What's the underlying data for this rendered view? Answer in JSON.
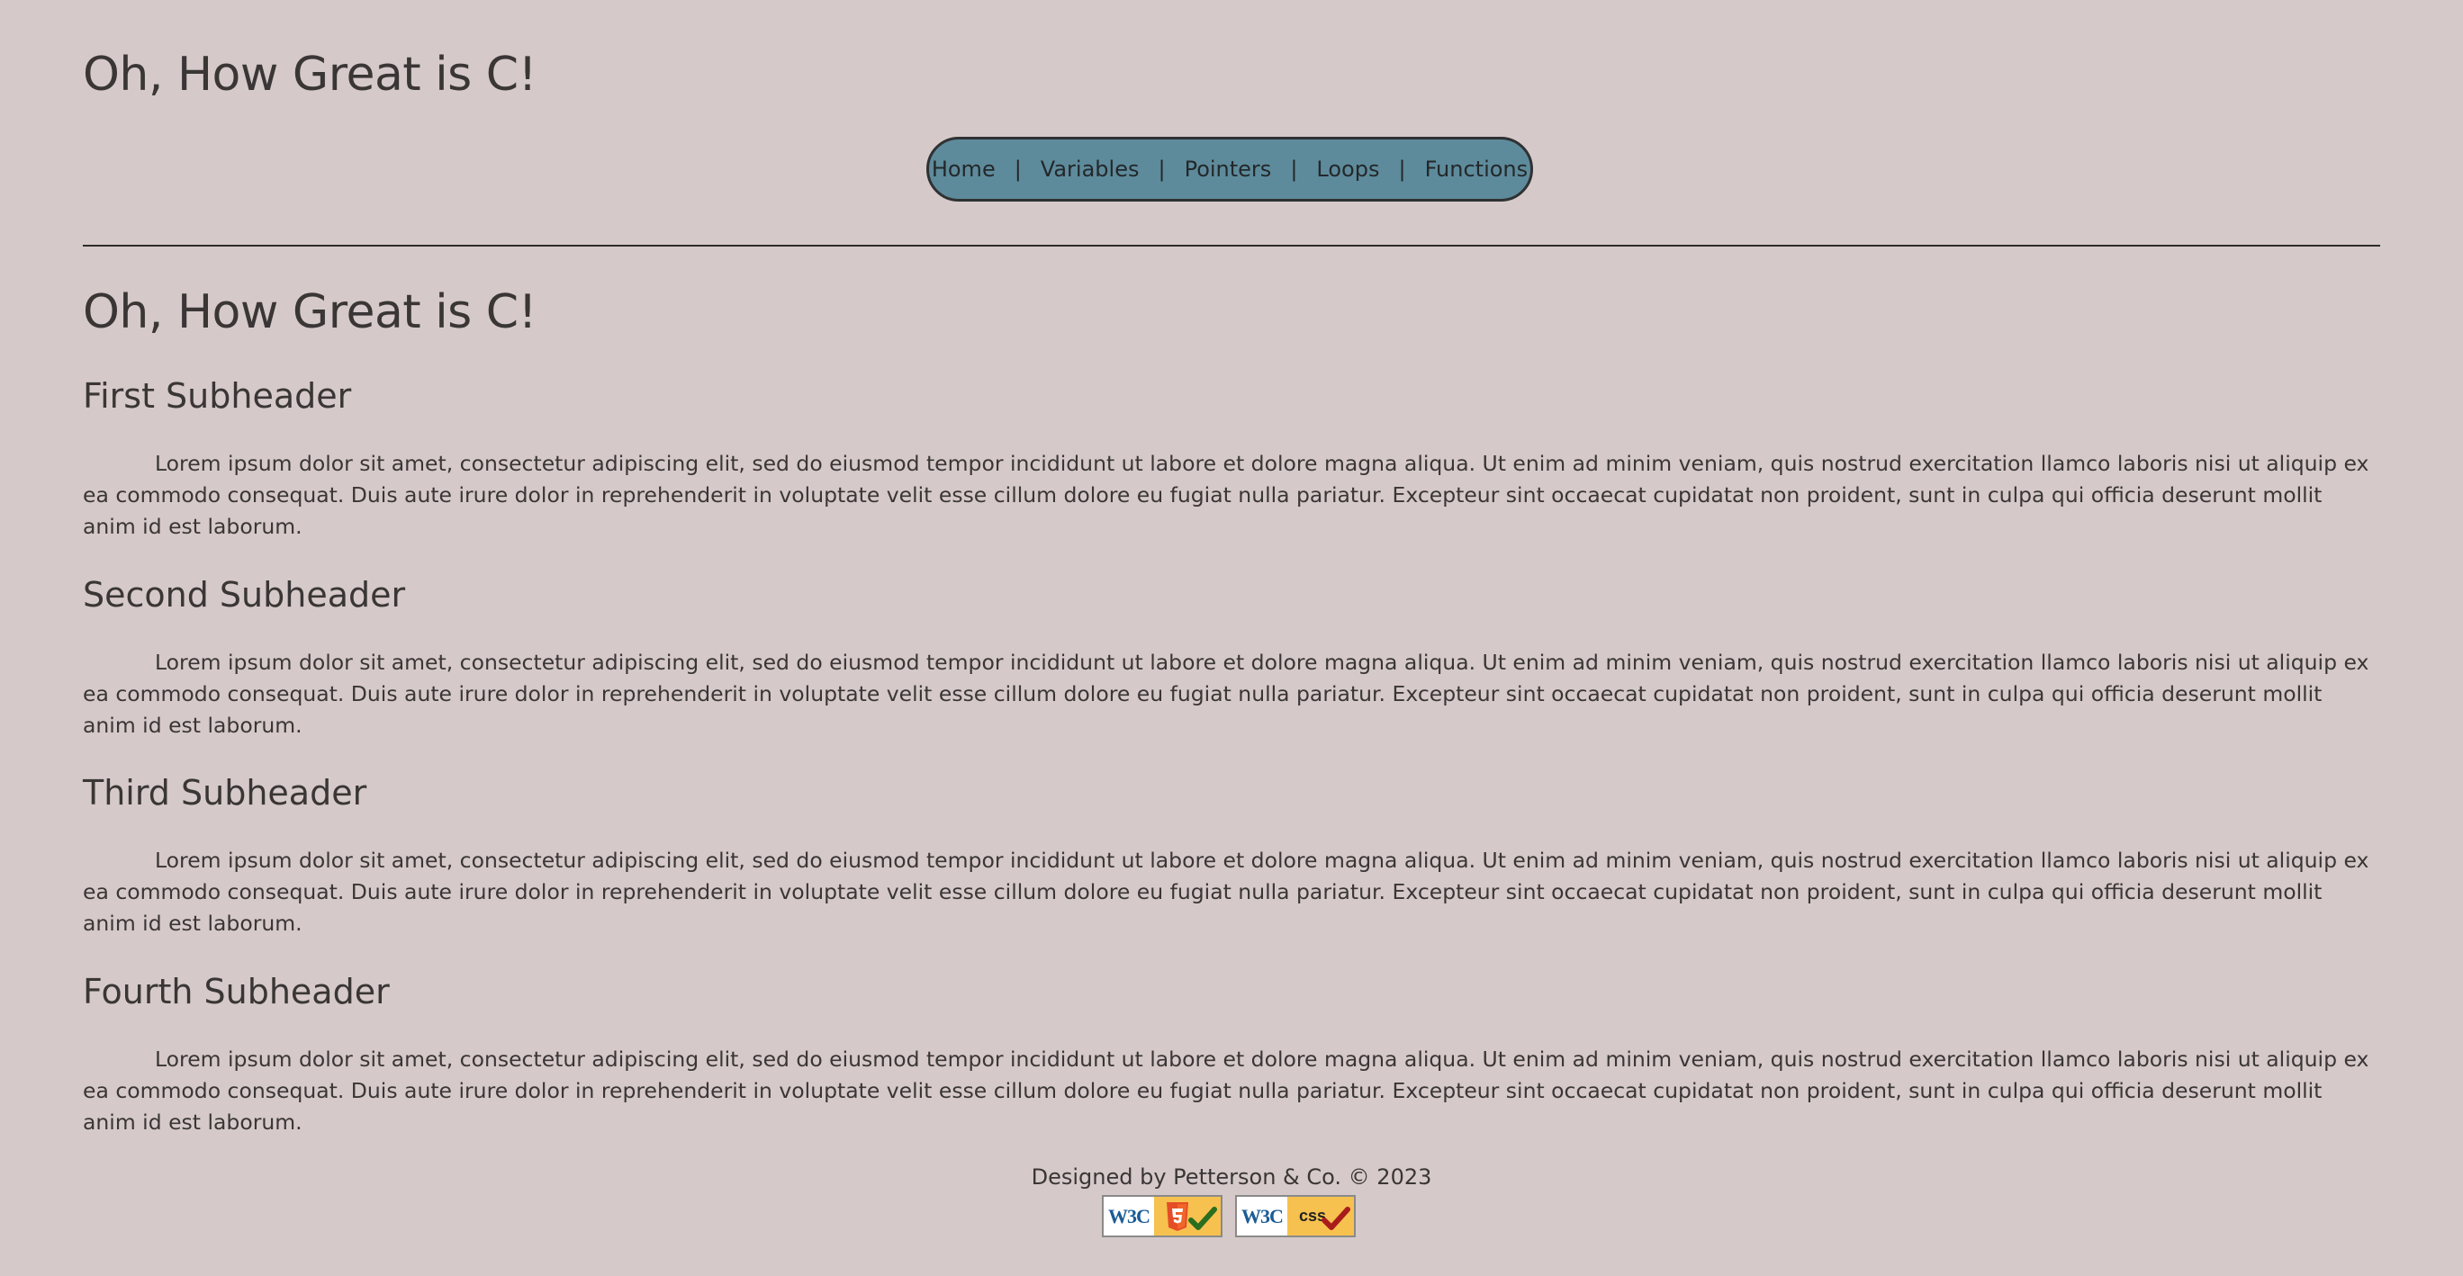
{
  "header": {
    "site_title": "Oh, How Great is C!"
  },
  "nav": {
    "items": [
      {
        "label": "Home"
      },
      {
        "label": "Variables"
      },
      {
        "label": "Pointers"
      },
      {
        "label": "Loops"
      },
      {
        "label": "Functions"
      }
    ],
    "separator": "|"
  },
  "main": {
    "heading": "Oh, How Great is C!",
    "sections": [
      {
        "title": "First Subheader",
        "body": "Lorem ipsum dolor sit amet, consectetur adipiscing elit, sed do eiusmod tempor incididunt ut labore et dolore magna aliqua. Ut enim ad minim veniam, quis nostrud exercitation llamco laboris nisi ut aliquip ex ea commodo consequat. Duis aute irure dolor in reprehenderit in voluptate velit esse cillum dolore eu fugiat nulla pariatur. Excepteur sint occaecat cupidatat non proident, sunt in culpa qui officia deserunt mollit anim id est laborum."
      },
      {
        "title": "Second Subheader",
        "body": "Lorem ipsum dolor sit amet, consectetur adipiscing elit, sed do eiusmod tempor incididunt ut labore et dolore magna aliqua. Ut enim ad minim veniam, quis nostrud exercitation llamco laboris nisi ut aliquip ex ea commodo consequat. Duis aute irure dolor in reprehenderit in voluptate velit esse cillum dolore eu fugiat nulla pariatur. Excepteur sint occaecat cupidatat non proident, sunt in culpa qui officia deserunt mollit anim id est laborum."
      },
      {
        "title": "Third Subheader",
        "body": "Lorem ipsum dolor sit amet, consectetur adipiscing elit, sed do eiusmod tempor incididunt ut labore et dolore magna aliqua. Ut enim ad minim veniam, quis nostrud exercitation llamco laboris nisi ut aliquip ex ea commodo consequat. Duis aute irure dolor in reprehenderit in voluptate velit esse cillum dolore eu fugiat nulla pariatur. Excepteur sint occaecat cupidatat non proident, sunt in culpa qui officia deserunt mollit anim id est laborum."
      },
      {
        "title": "Fourth Subheader",
        "body": "Lorem ipsum dolor sit amet, consectetur adipiscing elit, sed do eiusmod tempor incididunt ut labore et dolore magna aliqua. Ut enim ad minim veniam, quis nostrud exercitation llamco laboris nisi ut aliquip ex ea commodo consequat. Duis aute irure dolor in reprehenderit in voluptate velit esse cillum dolore eu fugiat nulla pariatur. Excepteur sint occaecat cupidatat non proident, sunt in culpa qui officia deserunt mollit anim id est laborum."
      }
    ]
  },
  "footer": {
    "credit": "Designed by Petterson & Co. © 2023",
    "badges": [
      {
        "logo_text": "W3C",
        "icon": "html5-valid-badge"
      },
      {
        "logo_text": "W3C",
        "label": "css",
        "icon": "css-valid-badge"
      }
    ]
  },
  "colors": {
    "background": "#d6c9ca",
    "nav_background": "#5e8b9b",
    "text": "#3a3636",
    "badge_yellow": "#f7c14f",
    "html5_orange": "#e44d26",
    "check_green": "#2a6e1f",
    "check_red": "#a81c1c"
  }
}
